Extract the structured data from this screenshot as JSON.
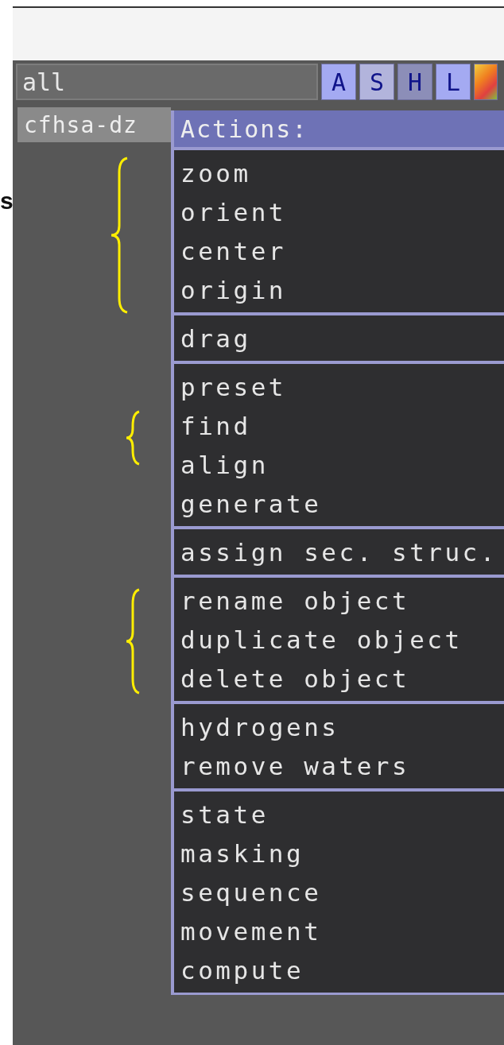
{
  "side_letter": "s",
  "selector": {
    "value": "all"
  },
  "buttons": [
    {
      "kind": "text",
      "label": "A",
      "color": "#a4aaf2"
    },
    {
      "kind": "text",
      "label": "S",
      "color": "#b2b4dc"
    },
    {
      "kind": "text",
      "label": "H",
      "color": "#8c8eb8"
    },
    {
      "kind": "text",
      "label": "L",
      "color": "#a4aaf2"
    },
    {
      "kind": "color"
    }
  ],
  "object": {
    "name": "cfhsa-dz"
  },
  "menu": {
    "title": "Actions:",
    "sections": [
      {
        "items": [
          "zoom",
          "orient",
          "center",
          "origin"
        ]
      },
      {
        "items": [
          "drag"
        ]
      },
      {
        "items": [
          "preset",
          "find",
          "align",
          "generate"
        ]
      },
      {
        "items": [
          "assign sec. struc."
        ]
      },
      {
        "items": [
          "rename object",
          "duplicate object",
          "delete object"
        ]
      },
      {
        "items": [
          "hydrogens",
          "remove waters"
        ]
      },
      {
        "items": [
          "state",
          "masking",
          "sequence",
          "movement",
          "compute"
        ]
      }
    ]
  }
}
